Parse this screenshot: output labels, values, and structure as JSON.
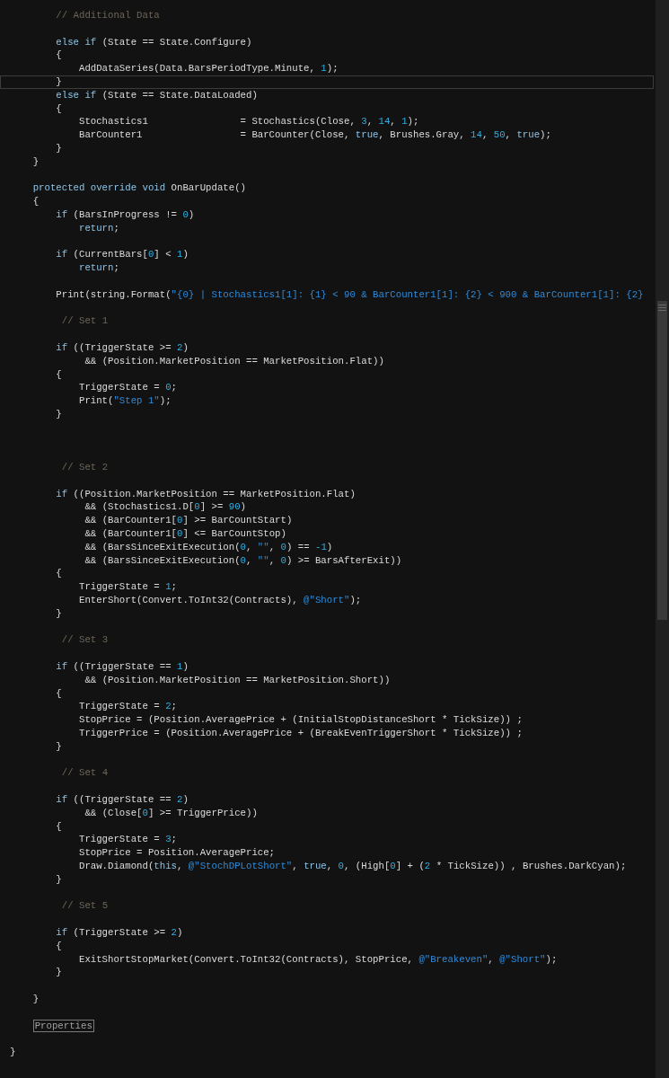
{
  "editor": {
    "lines": [
      {
        "kind": "code",
        "current": false,
        "tokens": [
          {
            "kind": "comment",
            "text": "        // Additional Data"
          }
        ]
      },
      {
        "kind": "blank",
        "current": false
      },
      {
        "kind": "code",
        "current": false,
        "tokens": [
          {
            "kind": "keyword",
            "text": "        else if"
          },
          {
            "kind": "plain",
            "text": " (State == State.Configure)"
          }
        ]
      },
      {
        "kind": "code",
        "current": false,
        "tokens": [
          {
            "kind": "plain",
            "text": "        {"
          }
        ]
      },
      {
        "kind": "code",
        "current": false,
        "tokens": [
          {
            "kind": "plain",
            "text": "            AddDataSeries(Data.BarsPeriodType.Minute, "
          },
          {
            "kind": "number",
            "text": "1"
          },
          {
            "kind": "plain",
            "text": ");"
          }
        ]
      },
      {
        "kind": "code",
        "current": true,
        "tokens": [
          {
            "kind": "plain",
            "text": "        }"
          }
        ]
      },
      {
        "kind": "code",
        "current": false,
        "tokens": [
          {
            "kind": "keyword",
            "text": "        else if"
          },
          {
            "kind": "plain",
            "text": " (State == State.DataLoaded)"
          }
        ]
      },
      {
        "kind": "code",
        "current": false,
        "tokens": [
          {
            "kind": "plain",
            "text": "        {"
          }
        ]
      },
      {
        "kind": "code",
        "current": false,
        "tokens": [
          {
            "kind": "plain",
            "text": "            Stochastics1                = Stochastics(Close, "
          },
          {
            "kind": "number",
            "text": "3"
          },
          {
            "kind": "plain",
            "text": ", "
          },
          {
            "kind": "number",
            "text": "14"
          },
          {
            "kind": "plain",
            "text": ", "
          },
          {
            "kind": "number",
            "text": "1"
          },
          {
            "kind": "plain",
            "text": ");"
          }
        ]
      },
      {
        "kind": "code",
        "current": false,
        "tokens": [
          {
            "kind": "plain",
            "text": "            BarCounter1                 = BarCounter(Close, "
          },
          {
            "kind": "keyword",
            "text": "true"
          },
          {
            "kind": "plain",
            "text": ", Brushes.Gray, "
          },
          {
            "kind": "number",
            "text": "14"
          },
          {
            "kind": "plain",
            "text": ", "
          },
          {
            "kind": "number",
            "text": "50"
          },
          {
            "kind": "plain",
            "text": ", "
          },
          {
            "kind": "keyword",
            "text": "true"
          },
          {
            "kind": "plain",
            "text": ");"
          }
        ]
      },
      {
        "kind": "code",
        "current": false,
        "tokens": [
          {
            "kind": "plain",
            "text": "        }"
          }
        ]
      },
      {
        "kind": "code",
        "current": false,
        "tokens": [
          {
            "kind": "plain",
            "text": "    }"
          }
        ]
      },
      {
        "kind": "blank",
        "current": false
      },
      {
        "kind": "code",
        "current": false,
        "tokens": [
          {
            "kind": "keyword",
            "text": "    protected override void"
          },
          {
            "kind": "plain",
            "text": " OnBarUpdate()"
          }
        ]
      },
      {
        "kind": "code",
        "current": false,
        "tokens": [
          {
            "kind": "plain",
            "text": "    {"
          }
        ]
      },
      {
        "kind": "code",
        "current": false,
        "tokens": [
          {
            "kind": "keyword",
            "text": "        if"
          },
          {
            "kind": "plain",
            "text": " (BarsInProgress != "
          },
          {
            "kind": "number",
            "text": "0"
          },
          {
            "kind": "plain",
            "text": ")"
          }
        ]
      },
      {
        "kind": "code",
        "current": false,
        "tokens": [
          {
            "kind": "keyword",
            "text": "            return"
          },
          {
            "kind": "plain",
            "text": ";"
          }
        ]
      },
      {
        "kind": "blank",
        "current": false
      },
      {
        "kind": "code",
        "current": false,
        "tokens": [
          {
            "kind": "keyword",
            "text": "        if"
          },
          {
            "kind": "plain",
            "text": " (CurrentBars["
          },
          {
            "kind": "number",
            "text": "0"
          },
          {
            "kind": "plain",
            "text": "] < "
          },
          {
            "kind": "number",
            "text": "1"
          },
          {
            "kind": "plain",
            "text": ")"
          }
        ]
      },
      {
        "kind": "code",
        "current": false,
        "tokens": [
          {
            "kind": "keyword",
            "text": "            return"
          },
          {
            "kind": "plain",
            "text": ";"
          }
        ]
      },
      {
        "kind": "blank",
        "current": false
      },
      {
        "kind": "code",
        "current": false,
        "tokens": [
          {
            "kind": "plain",
            "text": "        Print(string.Format("
          },
          {
            "kind": "string",
            "text": "\"{0} | Stochastics1[1]: {1} < 90 & BarCounter1[1]: {2} < 900 & BarCounter1[1]: {2}"
          }
        ]
      },
      {
        "kind": "blank",
        "current": false
      },
      {
        "kind": "code",
        "current": false,
        "tokens": [
          {
            "kind": "comment",
            "text": "         // Set 1"
          }
        ]
      },
      {
        "kind": "blank",
        "current": false
      },
      {
        "kind": "code",
        "current": false,
        "tokens": [
          {
            "kind": "keyword",
            "text": "        if"
          },
          {
            "kind": "plain",
            "text": " ((TriggerState >= "
          },
          {
            "kind": "number",
            "text": "2"
          },
          {
            "kind": "plain",
            "text": ")"
          }
        ]
      },
      {
        "kind": "code",
        "current": false,
        "tokens": [
          {
            "kind": "plain",
            "text": "             && (Position.MarketPosition == MarketPosition.Flat))"
          }
        ]
      },
      {
        "kind": "code",
        "current": false,
        "tokens": [
          {
            "kind": "plain",
            "text": "        {"
          }
        ]
      },
      {
        "kind": "code",
        "current": false,
        "tokens": [
          {
            "kind": "plain",
            "text": "            TriggerState = "
          },
          {
            "kind": "number",
            "text": "0"
          },
          {
            "kind": "plain",
            "text": ";"
          }
        ]
      },
      {
        "kind": "code",
        "current": false,
        "tokens": [
          {
            "kind": "plain",
            "text": "            Print("
          },
          {
            "kind": "string",
            "text": "\"Step 1\""
          },
          {
            "kind": "plain",
            "text": ");"
          }
        ]
      },
      {
        "kind": "code",
        "current": false,
        "tokens": [
          {
            "kind": "plain",
            "text": "        }"
          }
        ]
      },
      {
        "kind": "blank",
        "current": false
      },
      {
        "kind": "blank",
        "current": false
      },
      {
        "kind": "blank",
        "current": false
      },
      {
        "kind": "code",
        "current": false,
        "tokens": [
          {
            "kind": "comment",
            "text": "         // Set 2"
          }
        ]
      },
      {
        "kind": "blank",
        "current": false
      },
      {
        "kind": "code",
        "current": false,
        "tokens": [
          {
            "kind": "keyword",
            "text": "        if"
          },
          {
            "kind": "plain",
            "text": " ((Position.MarketPosition == MarketPosition.Flat)"
          }
        ]
      },
      {
        "kind": "code",
        "current": false,
        "tokens": [
          {
            "kind": "plain",
            "text": "             && (Stochastics1.D["
          },
          {
            "kind": "number",
            "text": "0"
          },
          {
            "kind": "plain",
            "text": "] >= "
          },
          {
            "kind": "number",
            "text": "90"
          },
          {
            "kind": "plain",
            "text": ")"
          }
        ]
      },
      {
        "kind": "code",
        "current": false,
        "tokens": [
          {
            "kind": "plain",
            "text": "             && (BarCounter1["
          },
          {
            "kind": "number",
            "text": "0"
          },
          {
            "kind": "plain",
            "text": "] >= BarCountStart)"
          }
        ]
      },
      {
        "kind": "code",
        "current": false,
        "tokens": [
          {
            "kind": "plain",
            "text": "             && (BarCounter1["
          },
          {
            "kind": "number",
            "text": "0"
          },
          {
            "kind": "plain",
            "text": "] <= BarCountStop)"
          }
        ]
      },
      {
        "kind": "code",
        "current": false,
        "tokens": [
          {
            "kind": "plain",
            "text": "             && (BarsSinceExitExecution("
          },
          {
            "kind": "number",
            "text": "0"
          },
          {
            "kind": "plain",
            "text": ", "
          },
          {
            "kind": "string",
            "text": "\"\""
          },
          {
            "kind": "plain",
            "text": ", "
          },
          {
            "kind": "number",
            "text": "0"
          },
          {
            "kind": "plain",
            "text": ") == "
          },
          {
            "kind": "number",
            "text": "-1"
          },
          {
            "kind": "plain",
            "text": ")"
          }
        ]
      },
      {
        "kind": "code",
        "current": false,
        "tokens": [
          {
            "kind": "plain",
            "text": "             && (BarsSinceExitExecution("
          },
          {
            "kind": "number",
            "text": "0"
          },
          {
            "kind": "plain",
            "text": ", "
          },
          {
            "kind": "string",
            "text": "\"\""
          },
          {
            "kind": "plain",
            "text": ", "
          },
          {
            "kind": "number",
            "text": "0"
          },
          {
            "kind": "plain",
            "text": ") >= BarsAfterExit))"
          }
        ]
      },
      {
        "kind": "code",
        "current": false,
        "tokens": [
          {
            "kind": "plain",
            "text": "        {"
          }
        ]
      },
      {
        "kind": "code",
        "current": false,
        "tokens": [
          {
            "kind": "plain",
            "text": "            TriggerState = "
          },
          {
            "kind": "number",
            "text": "1"
          },
          {
            "kind": "plain",
            "text": ";"
          }
        ]
      },
      {
        "kind": "code",
        "current": false,
        "tokens": [
          {
            "kind": "plain",
            "text": "            EnterShort(Convert.ToInt32(Contracts), "
          },
          {
            "kind": "string",
            "text": "@\"Short\""
          },
          {
            "kind": "plain",
            "text": ");"
          }
        ]
      },
      {
        "kind": "code",
        "current": false,
        "tokens": [
          {
            "kind": "plain",
            "text": "        }"
          }
        ]
      },
      {
        "kind": "blank",
        "current": false
      },
      {
        "kind": "code",
        "current": false,
        "tokens": [
          {
            "kind": "comment",
            "text": "         // Set 3"
          }
        ]
      },
      {
        "kind": "blank",
        "current": false
      },
      {
        "kind": "code",
        "current": false,
        "tokens": [
          {
            "kind": "keyword",
            "text": "        if"
          },
          {
            "kind": "plain",
            "text": " ((TriggerState == "
          },
          {
            "kind": "number",
            "text": "1"
          },
          {
            "kind": "plain",
            "text": ")"
          }
        ]
      },
      {
        "kind": "code",
        "current": false,
        "tokens": [
          {
            "kind": "plain",
            "text": "             && (Position.MarketPosition == MarketPosition.Short))"
          }
        ]
      },
      {
        "kind": "code",
        "current": false,
        "tokens": [
          {
            "kind": "plain",
            "text": "        {"
          }
        ]
      },
      {
        "kind": "code",
        "current": false,
        "tokens": [
          {
            "kind": "plain",
            "text": "            TriggerState = "
          },
          {
            "kind": "number",
            "text": "2"
          },
          {
            "kind": "plain",
            "text": ";"
          }
        ]
      },
      {
        "kind": "code",
        "current": false,
        "tokens": [
          {
            "kind": "plain",
            "text": "            StopPrice = (Position.AveragePrice + (InitialStopDistanceShort * TickSize)) ;"
          }
        ]
      },
      {
        "kind": "code",
        "current": false,
        "tokens": [
          {
            "kind": "plain",
            "text": "            TriggerPrice = (Position.AveragePrice + (BreakEvenTriggerShort * TickSize)) ;"
          }
        ]
      },
      {
        "kind": "code",
        "current": false,
        "tokens": [
          {
            "kind": "plain",
            "text": "        }"
          }
        ]
      },
      {
        "kind": "blank",
        "current": false
      },
      {
        "kind": "code",
        "current": false,
        "tokens": [
          {
            "kind": "comment",
            "text": "         // Set 4"
          }
        ]
      },
      {
        "kind": "blank",
        "current": false
      },
      {
        "kind": "code",
        "current": false,
        "tokens": [
          {
            "kind": "keyword",
            "text": "        if"
          },
          {
            "kind": "plain",
            "text": " ((TriggerState == "
          },
          {
            "kind": "number",
            "text": "2"
          },
          {
            "kind": "plain",
            "text": ")"
          }
        ]
      },
      {
        "kind": "code",
        "current": false,
        "tokens": [
          {
            "kind": "plain",
            "text": "             && (Close["
          },
          {
            "kind": "number",
            "text": "0"
          },
          {
            "kind": "plain",
            "text": "] >= TriggerPrice))"
          }
        ]
      },
      {
        "kind": "code",
        "current": false,
        "tokens": [
          {
            "kind": "plain",
            "text": "        {"
          }
        ]
      },
      {
        "kind": "code",
        "current": false,
        "tokens": [
          {
            "kind": "plain",
            "text": "            TriggerState = "
          },
          {
            "kind": "number",
            "text": "3"
          },
          {
            "kind": "plain",
            "text": ";"
          }
        ]
      },
      {
        "kind": "code",
        "current": false,
        "tokens": [
          {
            "kind": "plain",
            "text": "            StopPrice = Position.AveragePrice;"
          }
        ]
      },
      {
        "kind": "code",
        "current": false,
        "tokens": [
          {
            "kind": "plain",
            "text": "            Draw.Diamond("
          },
          {
            "kind": "keyword",
            "text": "this"
          },
          {
            "kind": "plain",
            "text": ", "
          },
          {
            "kind": "string",
            "text": "@\"StochDPLotShort\""
          },
          {
            "kind": "plain",
            "text": ", "
          },
          {
            "kind": "keyword",
            "text": "true"
          },
          {
            "kind": "plain",
            "text": ", "
          },
          {
            "kind": "number",
            "text": "0"
          },
          {
            "kind": "plain",
            "text": ", (High["
          },
          {
            "kind": "number",
            "text": "0"
          },
          {
            "kind": "plain",
            "text": "] + ("
          },
          {
            "kind": "number",
            "text": "2"
          },
          {
            "kind": "plain",
            "text": " * TickSize)) , Brushes.DarkCyan);"
          }
        ]
      },
      {
        "kind": "code",
        "current": false,
        "tokens": [
          {
            "kind": "plain",
            "text": "        }"
          }
        ]
      },
      {
        "kind": "blank",
        "current": false
      },
      {
        "kind": "code",
        "current": false,
        "tokens": [
          {
            "kind": "comment",
            "text": "         // Set 5"
          }
        ]
      },
      {
        "kind": "blank",
        "current": false
      },
      {
        "kind": "code",
        "current": false,
        "tokens": [
          {
            "kind": "keyword",
            "text": "        if"
          },
          {
            "kind": "plain",
            "text": " (TriggerState >= "
          },
          {
            "kind": "number",
            "text": "2"
          },
          {
            "kind": "plain",
            "text": ")"
          }
        ]
      },
      {
        "kind": "code",
        "current": false,
        "tokens": [
          {
            "kind": "plain",
            "text": "        {"
          }
        ]
      },
      {
        "kind": "code",
        "current": false,
        "tokens": [
          {
            "kind": "plain",
            "text": "            ExitShortStopMarket(Convert.ToInt32(Contracts), StopPrice, "
          },
          {
            "kind": "string",
            "text": "@\"Breakeven\""
          },
          {
            "kind": "plain",
            "text": ", "
          },
          {
            "kind": "string",
            "text": "@\"Short\""
          },
          {
            "kind": "plain",
            "text": ");"
          }
        ]
      },
      {
        "kind": "code",
        "current": false,
        "tokens": [
          {
            "kind": "plain",
            "text": "        }"
          }
        ]
      },
      {
        "kind": "blank",
        "current": false
      },
      {
        "kind": "code",
        "current": false,
        "tokens": [
          {
            "kind": "plain",
            "text": "    }"
          }
        ]
      },
      {
        "kind": "blank",
        "current": false
      },
      {
        "kind": "region",
        "current": false,
        "tokens": [
          {
            "kind": "plain",
            "text": "    Properties"
          }
        ]
      },
      {
        "kind": "blank",
        "current": false
      },
      {
        "kind": "code",
        "current": false,
        "tokens": [
          {
            "kind": "plain",
            "text": "}"
          }
        ]
      }
    ]
  }
}
